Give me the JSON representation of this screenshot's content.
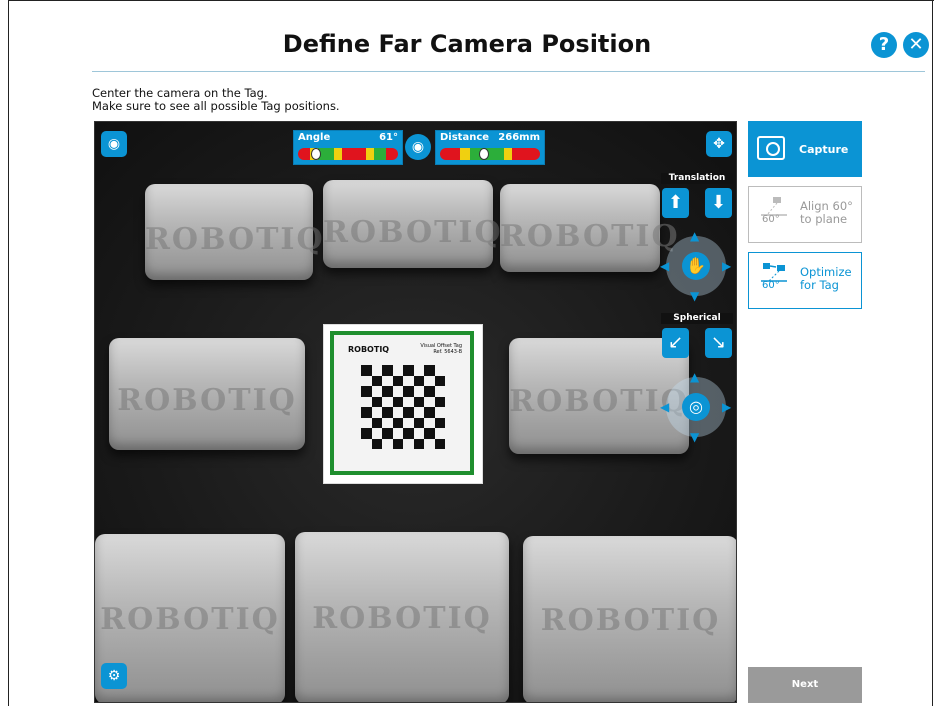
{
  "header": {
    "title": "Define Far Camera Position",
    "help_symbol": "?",
    "close_symbol": "✕"
  },
  "instructions": {
    "line1": "Center the camera on the Tag.",
    "line2": "Make sure to see all possible Tag positions."
  },
  "camera": {
    "brand_text": "ROBOTIQ",
    "tag": {
      "brand": "ROBOTIQ",
      "small_line1": "Visual Offset Tag",
      "small_line2": "Ref. 5643-B"
    },
    "angle_meter": {
      "label": "Angle",
      "value": "61°",
      "position": 0.18
    },
    "distance_meter": {
      "label": "Distance",
      "value": "266mm",
      "position": 0.44
    },
    "translation_label": "Translation",
    "spherical_label": "Spherical",
    "icons": [
      "eye-icon",
      "view-toggle-icon",
      "move-icon",
      "camera-settings-icon"
    ]
  },
  "side_panel": {
    "capture": {
      "label": "Capture"
    },
    "align": {
      "line1": "Align 60°",
      "line2": "to plane",
      "deg": "60°"
    },
    "optimize": {
      "line1": "Optimize",
      "line2": "for Tag",
      "deg": "60°"
    }
  },
  "footer": {
    "next_label": "Next"
  },
  "colors": {
    "accent": "#0b94d4",
    "tag_border": "#1f8f2e",
    "disabled": "#9a9a9a"
  }
}
